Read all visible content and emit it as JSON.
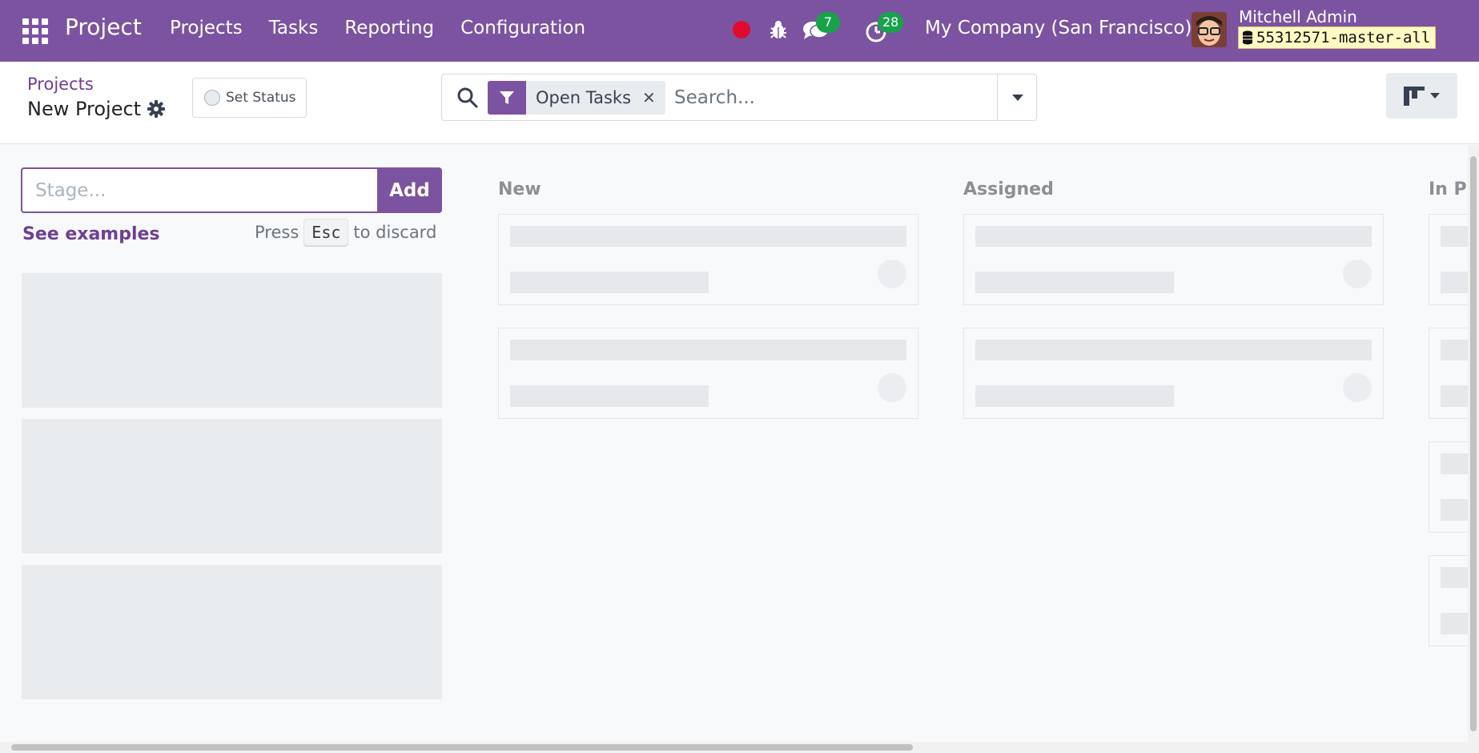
{
  "navbar": {
    "brand": "Project",
    "menu": [
      "Projects",
      "Tasks",
      "Reporting",
      "Configuration"
    ],
    "chat_badge": "7",
    "activity_badge": "28",
    "company": "My Company (San Francisco)",
    "user_name": "Mitchell Admin",
    "database": "55312571-master-all",
    "colors": {
      "navbar_bg": "#7c53a0",
      "record_dot": "#e00b2b",
      "badge": "#16a34a"
    }
  },
  "control_panel": {
    "breadcrumb": "Projects",
    "title": "New Project",
    "set_status_label": "Set Status",
    "search": {
      "facet": "Open Tasks",
      "placeholder": "Search..."
    }
  },
  "kanban": {
    "quick_create": {
      "placeholder": "Stage...",
      "add_label": "Add",
      "see_examples": "See examples",
      "hint_press": "Press",
      "hint_key": "Esc",
      "hint_discard": "to discard"
    },
    "columns": [
      {
        "title": "New"
      },
      {
        "title": "Assigned"
      },
      {
        "title": "In Pr"
      }
    ]
  }
}
